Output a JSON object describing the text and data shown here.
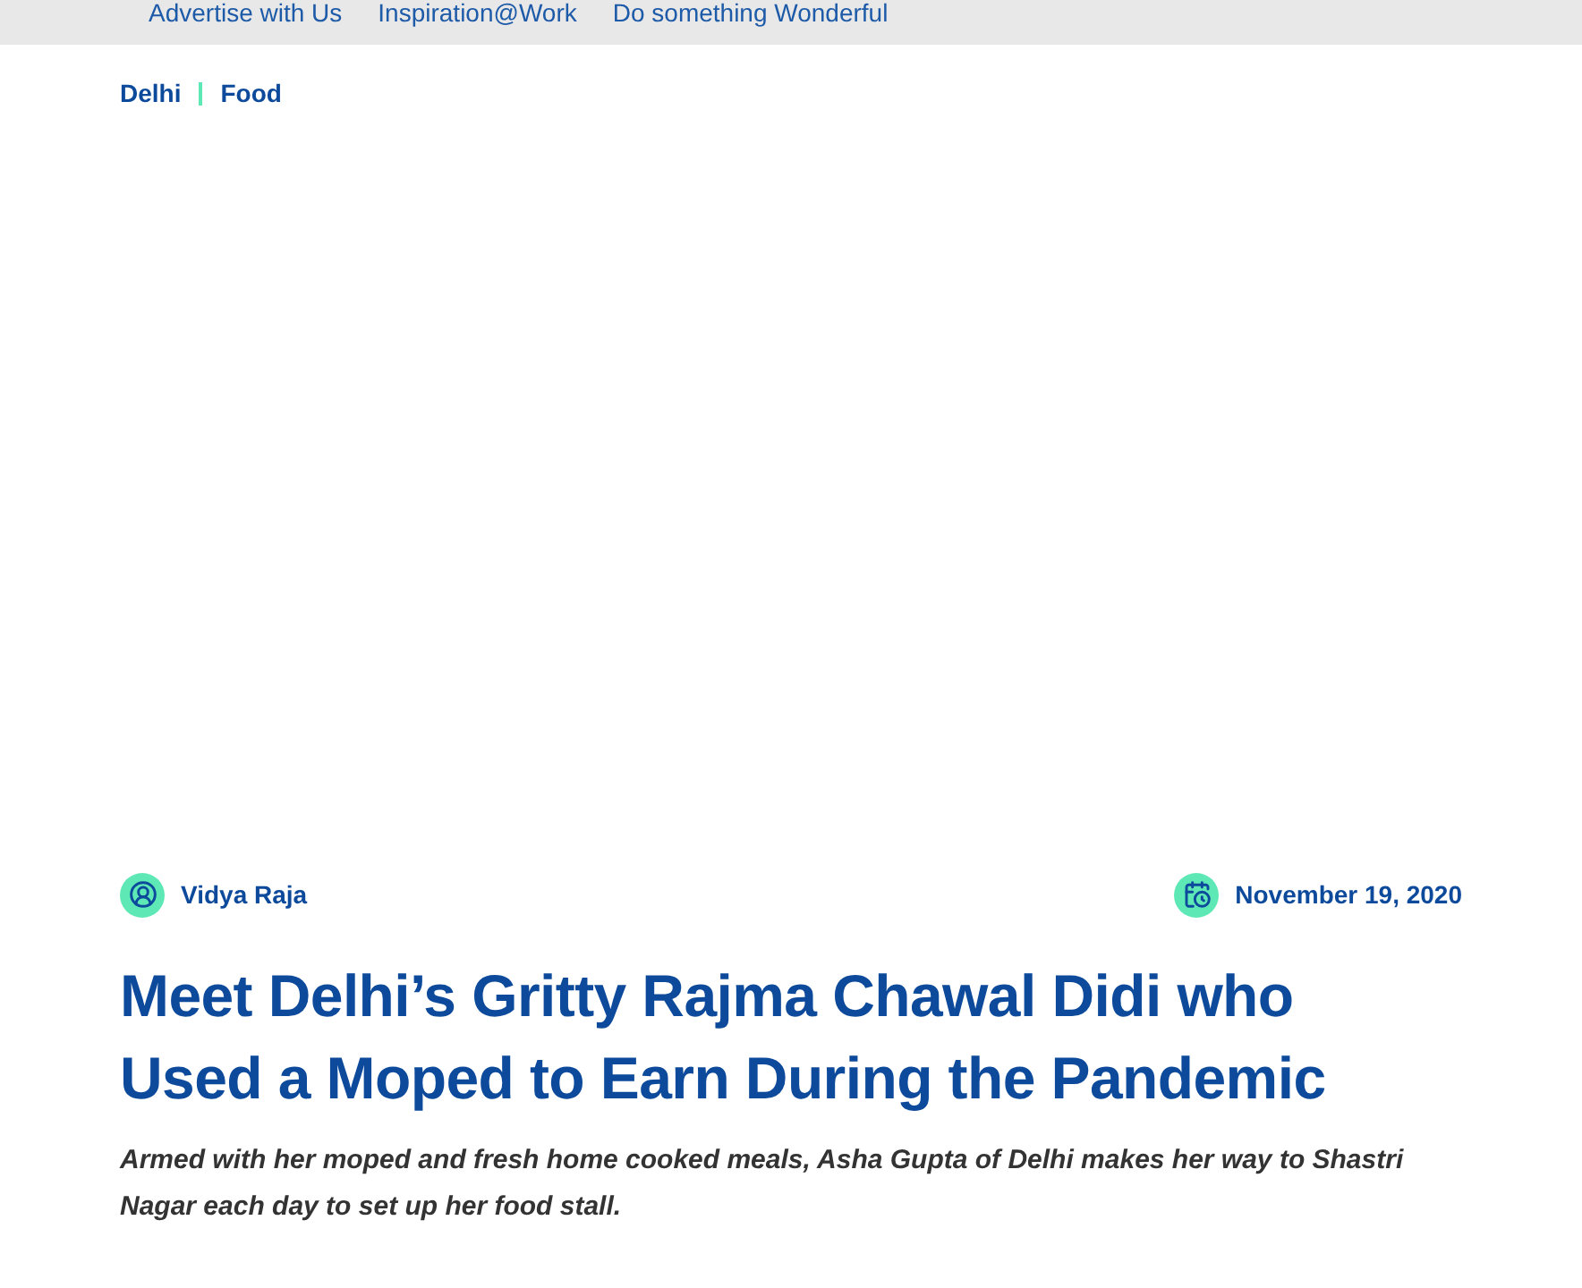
{
  "top_nav": {
    "links": [
      "Advertise with Us",
      "Inspiration@Work",
      "Do something Wonderful"
    ]
  },
  "breadcrumb": [
    "Delhi",
    "Food"
  ],
  "article": {
    "author": "Vidya Raja",
    "date": "November 19, 2020",
    "title": "Meet Delhi’s Gritty Rajma Chawal Didi who Used a Moped to Earn During the Pandemic",
    "summary": "Armed with her moped and fresh home cooked meals, Asha Gupta of Delhi makes her way to Shastri Nagar each day to set up her food stall."
  }
}
